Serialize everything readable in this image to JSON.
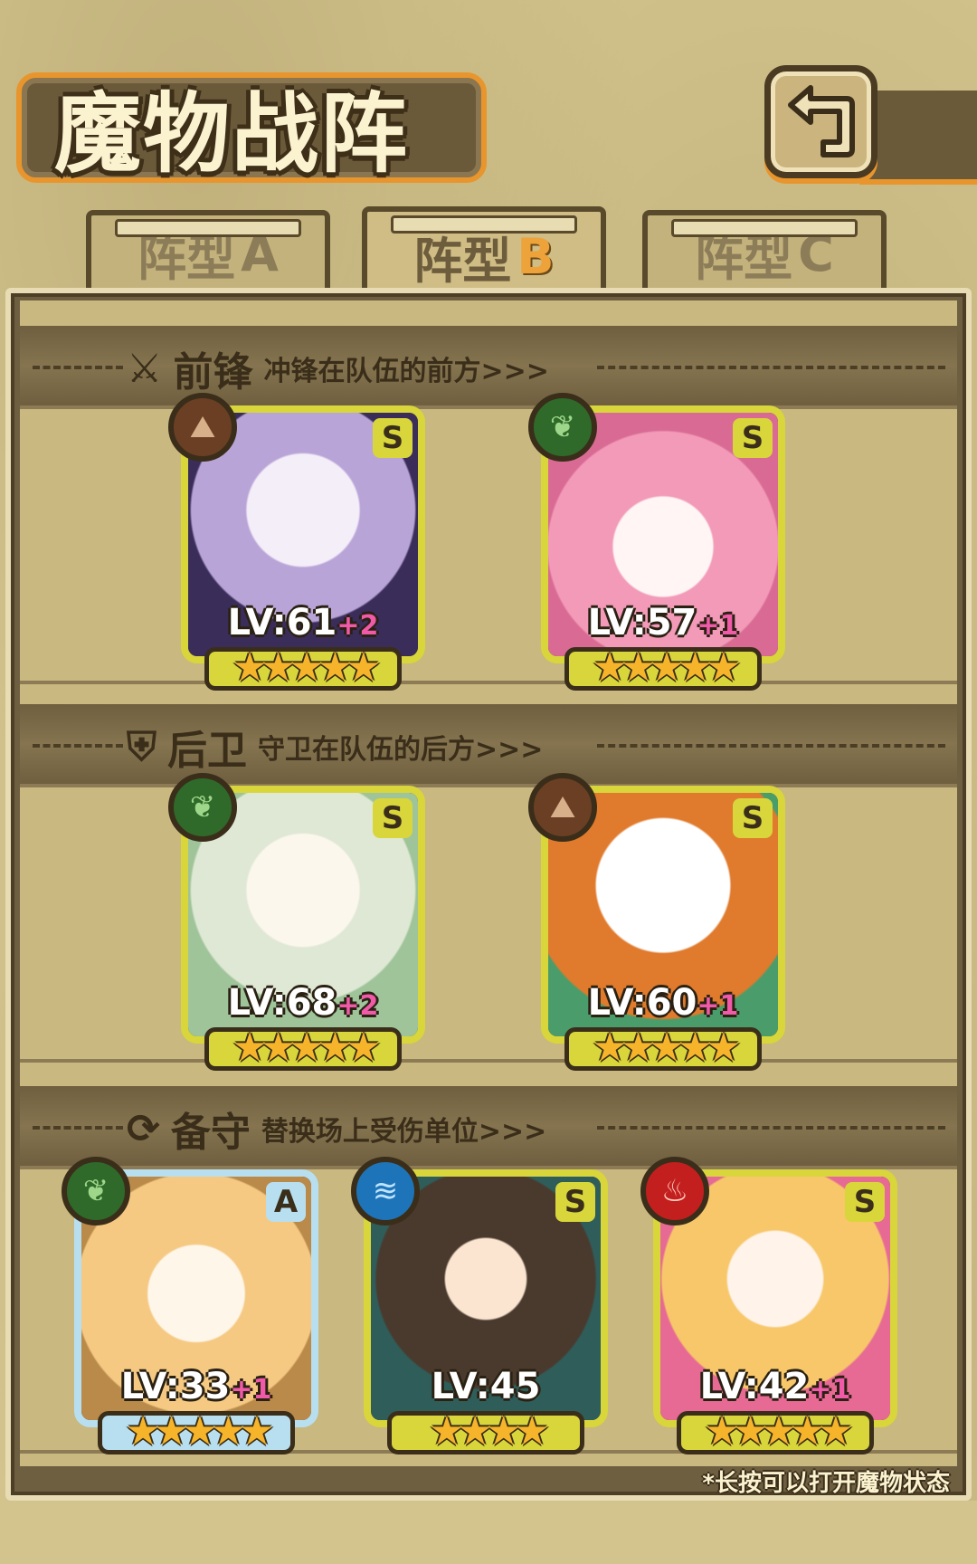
{
  "header": {
    "title": "魔物战阵"
  },
  "tabs": [
    {
      "prefix": "阵型",
      "letter": "A"
    },
    {
      "prefix": "阵型",
      "letter": "B"
    },
    {
      "prefix": "阵型",
      "letter": "C"
    }
  ],
  "sections": {
    "front": {
      "title": "前锋",
      "subtitle": "冲锋在队伍的前方>>>"
    },
    "back": {
      "title": "后卫",
      "subtitle": "守卫在队伍的后方>>>"
    },
    "reserve": {
      "title": "备守",
      "subtitle": "替换场上受伤单位>>>"
    }
  },
  "cards": [
    {
      "rank": "S",
      "level": "LV:61",
      "plus": "+2",
      "stars": "★★★★★",
      "element": "earth",
      "color": "#6b3f24"
    },
    {
      "rank": "S",
      "level": "LV:57",
      "plus": "+1",
      "stars": "★★★★★",
      "element": "wood",
      "color": "#2f6a2a"
    },
    {
      "rank": "S",
      "level": "LV:68",
      "plus": "+2",
      "stars": "★★★★★",
      "element": "wood",
      "color": "#2f6a2a"
    },
    {
      "rank": "S",
      "level": "LV:60",
      "plus": "+1",
      "stars": "★★★★★",
      "element": "earth",
      "color": "#6b3f24"
    },
    {
      "rank": "A",
      "level": "LV:33",
      "plus": "+1",
      "stars": "★★★★★",
      "element": "wood",
      "color": "#2f6a2a"
    },
    {
      "rank": "S",
      "level": "LV:45",
      "plus": "",
      "stars": "★★★★",
      "element": "water",
      "color": "#1e74b8"
    },
    {
      "rank": "S",
      "level": "LV:42",
      "plus": "+1",
      "stars": "★★★★★",
      "element": "fire",
      "color": "#c41f1f"
    }
  ],
  "hint": "*长按可以打开魔物状态"
}
